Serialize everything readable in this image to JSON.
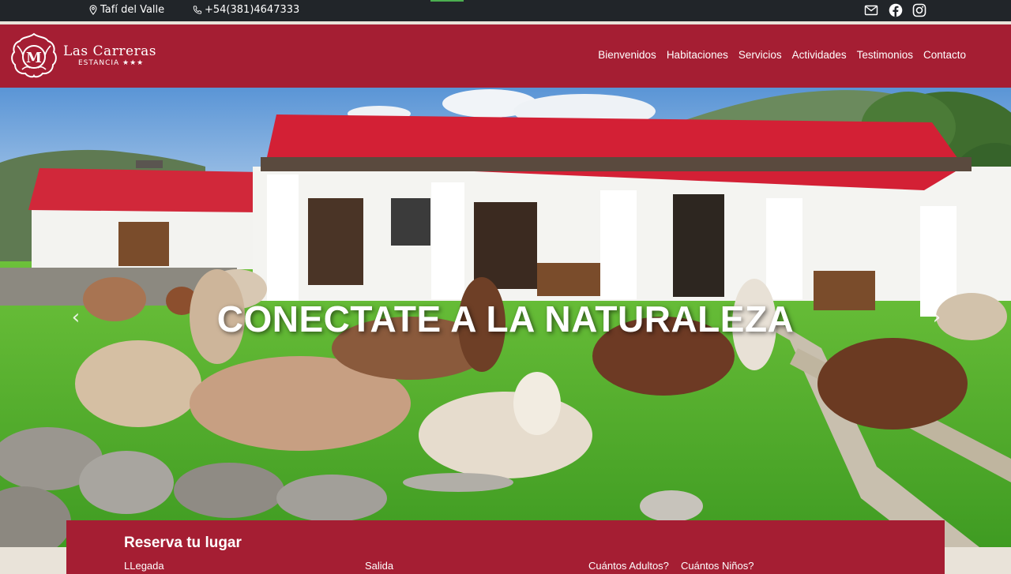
{
  "topbar": {
    "location": "Tafí del Valle",
    "phone": "+54(381)4647333",
    "social": [
      {
        "icon": "envelope-icon"
      },
      {
        "icon": "facebook-icon"
      },
      {
        "icon": "instagram-icon"
      }
    ]
  },
  "brand": {
    "name": "Las Carreras",
    "subtitle": "ESTANCIA ★★★",
    "emblem_letter": "M",
    "color": "#a51e33"
  },
  "nav": {
    "items": [
      {
        "label": "Bienvenidos"
      },
      {
        "label": "Habitaciones"
      },
      {
        "label": "Servicios"
      },
      {
        "label": "Actividades"
      },
      {
        "label": "Testimonios"
      },
      {
        "label": "Contacto"
      }
    ]
  },
  "hero": {
    "title": "CONECTATE A LA NATURALEZA",
    "prev_arrow": "‹",
    "next_arrow": "›"
  },
  "booking": {
    "title": "Reserva tu lugar",
    "arrival_label": "LLegada",
    "departure_label": "Salida",
    "adults_label": "Cuántos Adultos?",
    "children_label": "Cuántos Niños?"
  },
  "colors": {
    "topbar": "#212529",
    "header": "#a51e33",
    "page_bg": "#e9e3d9"
  }
}
